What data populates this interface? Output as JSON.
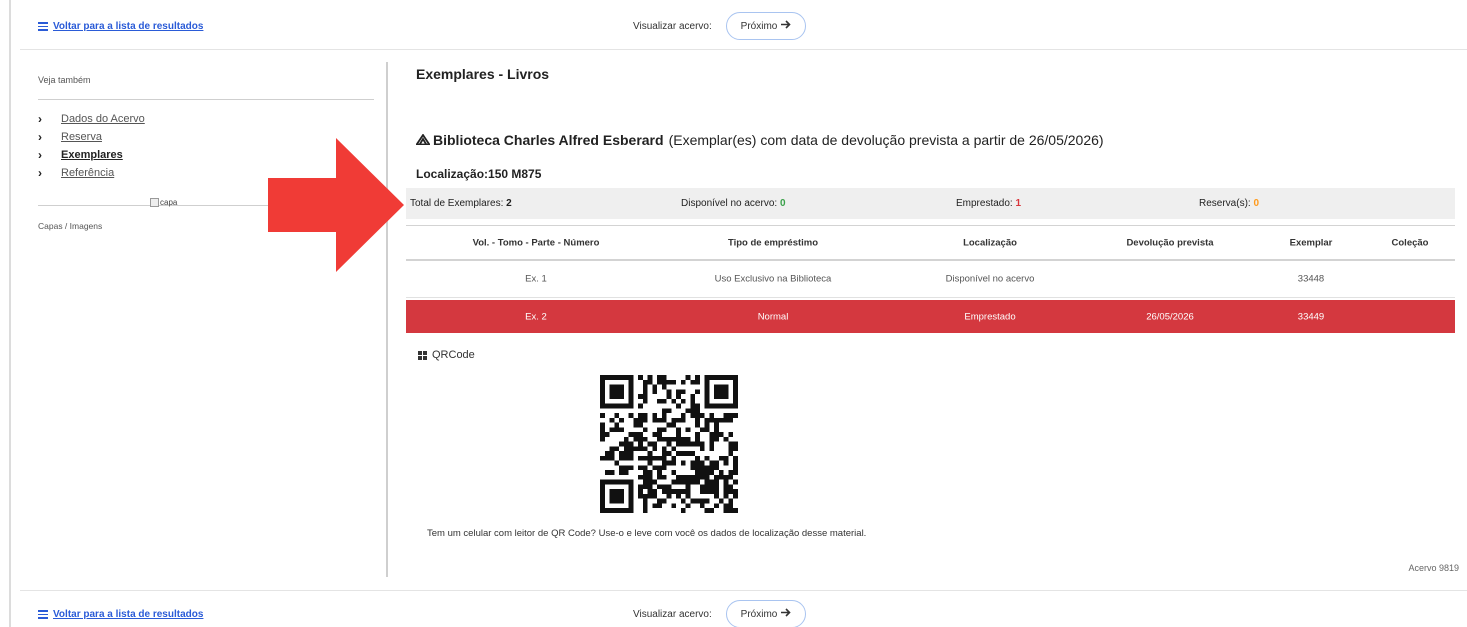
{
  "nav": {
    "back_label": "Voltar para a lista de resultados",
    "view_label": "Visualizar acervo:",
    "next_label": "Próximo",
    "next_arrow": "🡒"
  },
  "sidebar": {
    "see_also": "Veja também",
    "items": [
      {
        "label": "Dados do Acervo",
        "active": false
      },
      {
        "label": "Reserva",
        "active": false
      },
      {
        "label": "Exemplares",
        "active": true
      },
      {
        "label": "Referência",
        "active": false
      }
    ],
    "covers_label": "Capas / Imagens",
    "cover_alt": "capa"
  },
  "main": {
    "title": "Exemplares - Livros",
    "library_icon": "ᴀ",
    "library_name": "Biblioteca Charles Alfred Esberard",
    "library_note": "(Exemplar(es) com data de devolução prevista a partir de 26/05/2026)",
    "location": "Localização:150 M875",
    "totals": {
      "total_label": "Total de Exemplares:",
      "total_value": "2",
      "available_label": "Disponível no acervo:",
      "available_value": "0",
      "loaned_label": "Emprestado:",
      "loaned_value": "1",
      "reserves_label": "Reserva(s):",
      "reserves_value": "0"
    },
    "table": {
      "headers": [
        "Vol. - Tomo - Parte - Número",
        "Tipo de empréstimo",
        "Localização",
        "Devolução prevista",
        "Exemplar",
        "Coleção"
      ],
      "rows": [
        [
          "Ex. 1",
          "Uso Exclusivo na Biblioteca",
          "Disponível no acervo",
          "",
          "33448",
          ""
        ],
        [
          "Ex. 2",
          "Normal",
          "Emprestado",
          "26/05/2026",
          "33449",
          ""
        ]
      ]
    },
    "qr_title": "QRCode",
    "qr_caption": "Tem um celular com leitor de QR Code? Use-o e leve com você os dados de localização desse material.",
    "acervo_id": "Acervo 9819"
  },
  "colors": {
    "link": "#2a5bd7",
    "loaned_row": "#d4383f",
    "arrow": "#f03b36",
    "available": "#3aa14a",
    "loaned": "#d9353b",
    "reserves": "#ff9a1c"
  }
}
